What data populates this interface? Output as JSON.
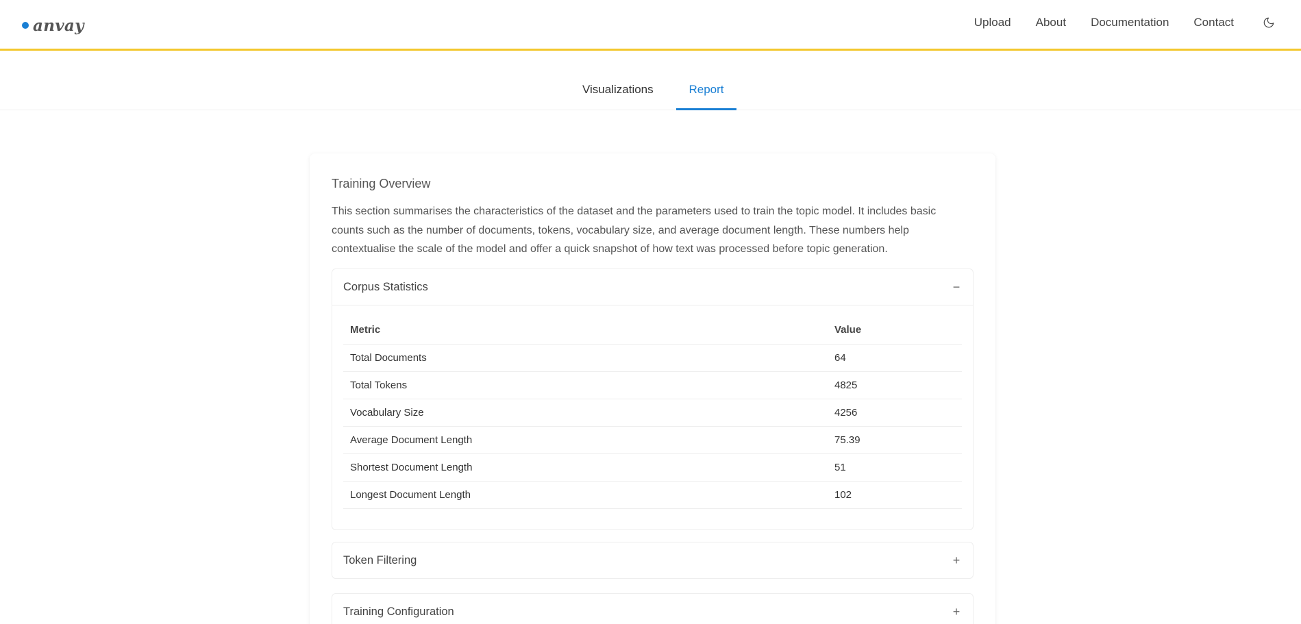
{
  "header": {
    "logo_text": "anvay",
    "nav": [
      "Upload",
      "About",
      "Documentation",
      "Contact"
    ],
    "theme_icon": "moon-icon",
    "accent_color": "#f3c72c",
    "brand_color": "#1a7fd4"
  },
  "tabs": [
    {
      "label": "Visualizations",
      "active": false
    },
    {
      "label": "Report",
      "active": true
    }
  ],
  "overview": {
    "title": "Training Overview",
    "description": "This section summarises the characteristics of the dataset and the parameters used to train the topic model. It includes basic counts such as the number of documents, tokens, vocabulary size, and average document length. These numbers help contextualise the scale of the model and offer a quick snapshot of how text was processed before topic generation."
  },
  "panels": [
    {
      "title": "Corpus Statistics",
      "toggle": "−",
      "expanded": true,
      "columns": [
        "Metric",
        "Value"
      ],
      "rows": [
        [
          "Total Documents",
          "64"
        ],
        [
          "Total Tokens",
          "4825"
        ],
        [
          "Vocabulary Size",
          "4256"
        ],
        [
          "Average Document Length",
          "75.39"
        ],
        [
          "Shortest Document Length",
          "51"
        ],
        [
          "Longest Document Length",
          "102"
        ]
      ]
    },
    {
      "title": "Token Filtering",
      "toggle": "+",
      "expanded": false
    },
    {
      "title": "Training Configuration",
      "toggle": "+",
      "expanded": false
    }
  ]
}
